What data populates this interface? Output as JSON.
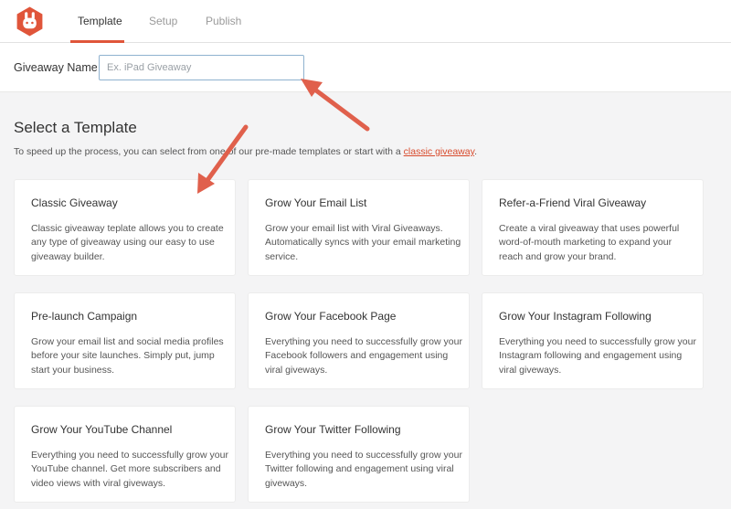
{
  "header": {
    "tabs": [
      {
        "label": "Template",
        "active": true
      },
      {
        "label": "Setup",
        "active": false
      },
      {
        "label": "Publish",
        "active": false
      }
    ]
  },
  "giveaway": {
    "label": "Giveaway Name",
    "value": "",
    "placeholder": "Ex. iPad Giveaway"
  },
  "templates": {
    "title": "Select a Template",
    "intro_text": "To speed up the process, you can select from one of our pre-made templates or start with a",
    "intro_link": "classic giveaway",
    "intro_end": ".",
    "cards": [
      {
        "title": "Classic Giveaway",
        "description": "Classic giveaway teplate allows you to create any type of giveaway using our easy to use giveaway builder."
      },
      {
        "title": "Grow Your Email List",
        "description": "Grow your email list with Viral Giveaways. Automatically syncs with your email marketing service."
      },
      {
        "title": "Refer-a-Friend Viral Giveaway",
        "description": "Create a viral giveaway that uses powerful word-of-mouth marketing to expand your reach and grow your brand."
      },
      {
        "title": "Pre-launch Campaign",
        "description": "Grow your email list and social media profiles before your site launches. Simply put, jump start your business."
      },
      {
        "title": "Grow Your Facebook Page",
        "description": "Everything you need to successfully grow your Facebook followers and engagement using viral giveways."
      },
      {
        "title": "Grow Your Instagram Following",
        "description": "Everything you need to successfully grow your Instagram following and engagement using viral giveways."
      },
      {
        "title": "Grow Your YouTube Channel",
        "description": "Everything you need to successfully grow your YouTube channel. Get more subscribers and video views with viral giveways."
      },
      {
        "title": "Grow Your Twitter Following",
        "description": "Everything you need to successfully grow your Twitter following and engagement using viral giveways."
      }
    ]
  },
  "colors": {
    "accent": "#e0553a",
    "annotation_arrow": "#e0604c",
    "input_border": "#8fb2cf"
  },
  "icons": {
    "logo": "rabbit-logo-icon"
  }
}
